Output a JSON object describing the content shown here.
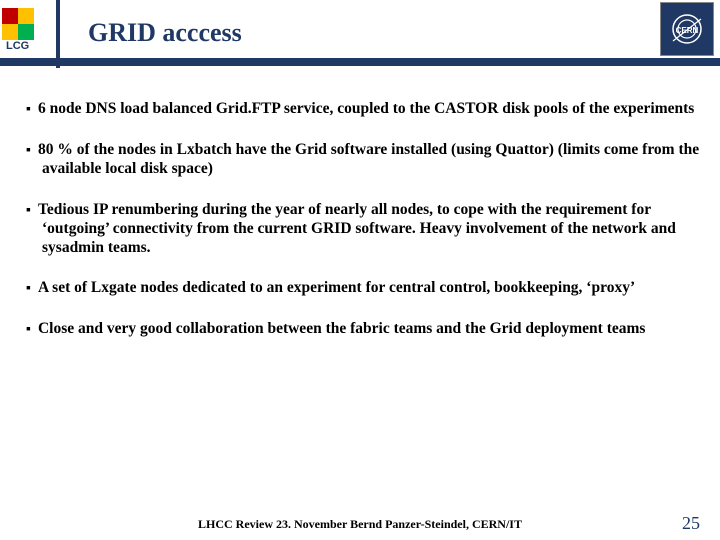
{
  "header": {
    "lcg_text": "LCG",
    "title": "GRID acccess",
    "cern_label": "CERN"
  },
  "bullets": [
    "6 node DNS load balanced Grid.FTP service, coupled to the CASTOR disk pools of the experiments",
    "80 % of the nodes in Lxbatch have the Grid software installed (using Quattor) (limits come from the available local disk space)",
    "Tedious IP renumbering during the year of nearly all nodes, to cope with the requirement for ‘outgoing’ connectivity from the current GRID software. Heavy involvement of the network and sysadmin teams.",
    "A set of Lxgate nodes dedicated to an experiment for central control, bookkeeping, ‘proxy’",
    "Close and very good collaboration between the fabric teams and the Grid deployment teams"
  ],
  "footer": {
    "text": "LHCC Review 23. November   Bernd Panzer-Steindel,  CERN/IT",
    "page": "25"
  }
}
